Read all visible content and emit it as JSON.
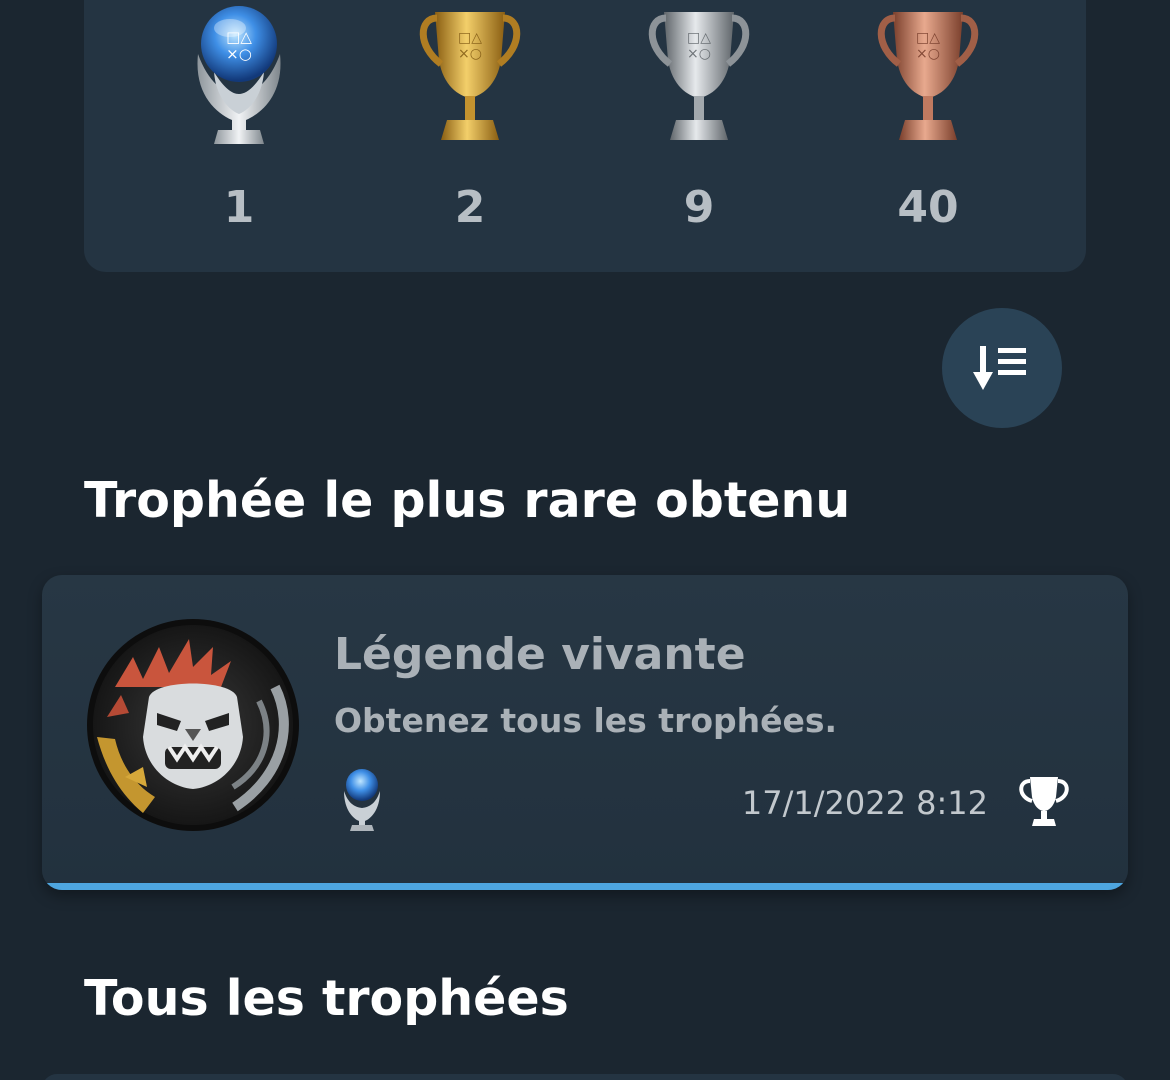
{
  "trophy_counts": [
    {
      "grade": "platinum",
      "count": "1"
    },
    {
      "grade": "gold",
      "count": "2"
    },
    {
      "grade": "silver",
      "count": "9"
    },
    {
      "grade": "bronze",
      "count": "40"
    }
  ],
  "sort": {
    "icon": "sort-descending-icon"
  },
  "rarest_section": {
    "title": "Trophée le plus rare obtenu",
    "trophy": {
      "name": "Légende vivante",
      "description": "Obtenez tous les trophées.",
      "grade": "platinum",
      "date": "17/1/2022",
      "time": "8:12",
      "date_time": "17/1/2022  8:12",
      "status_icon": "trophy-earned-icon"
    }
  },
  "all_section": {
    "title": "Tous les trophées"
  },
  "colors": {
    "background": "#1b2630",
    "card": "#243442",
    "accent": "#4ea6e0",
    "platinum": "#4d8fe0",
    "gold": "#c9962e",
    "silver": "#a5a9ad",
    "bronze": "#b9725a"
  }
}
